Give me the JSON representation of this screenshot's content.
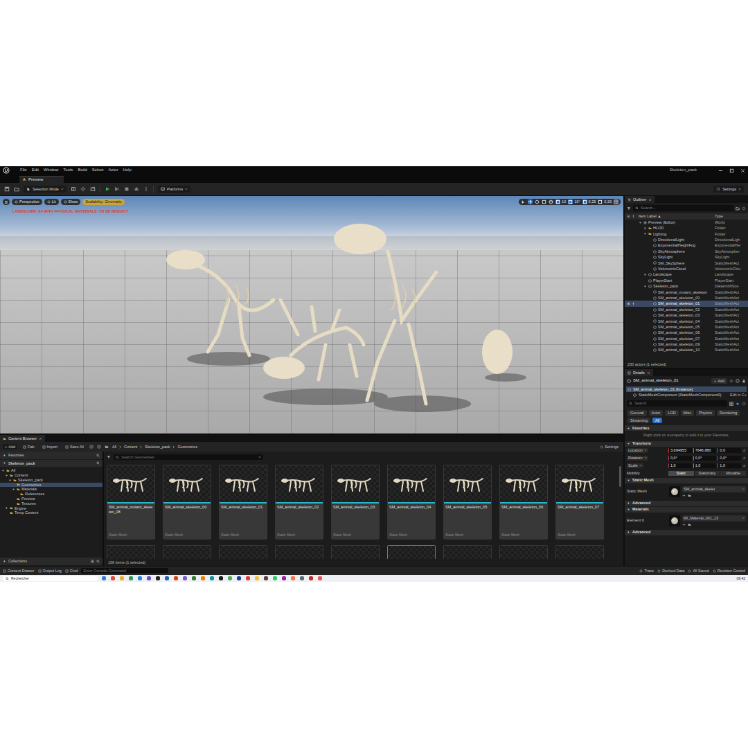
{
  "window": {
    "title": "Skeleton_pack",
    "menu": [
      "File",
      "Edit",
      "Window",
      "Tools",
      "Build",
      "Select",
      "Actor",
      "Help"
    ],
    "tab": "Preview"
  },
  "toolbar": {
    "mode": "Selection Mode",
    "platforms": "Platforms",
    "settings": "Settings"
  },
  "viewport": {
    "buttons": [
      "Perspective",
      "Lit",
      "Show"
    ],
    "scalability": "Scalability: Cinematic",
    "warning": "LANDSCAPE: 64 WITH PHYSICAL MATERIALS: TO BE REBUILT",
    "snaps": [
      {
        "value": "10",
        "on": true
      },
      {
        "value": "10°",
        "on": true
      },
      {
        "value": "0,25",
        "on": true
      },
      {
        "value": "0,33",
        "on": false
      }
    ]
  },
  "outliner": {
    "title": "Outliner",
    "search": "Search...",
    "columns": [
      "Item Label ▲",
      "Type"
    ],
    "footer": "230 actors (1 selected)",
    "rows": [
      {
        "label": "Preview (Editor)",
        "type": "World",
        "depth": 0,
        "kind": "world",
        "has_children": true,
        "expanded": true,
        "selected": false
      },
      {
        "label": "HLOD",
        "type": "Folder",
        "depth": 1,
        "kind": "folder",
        "has_children": true,
        "expanded": false,
        "selected": false
      },
      {
        "label": "Lighting",
        "type": "Folder",
        "depth": 1,
        "kind": "folder",
        "has_children": true,
        "expanded": true,
        "selected": false
      },
      {
        "label": "DirectionalLight",
        "type": "DirectionalLigh",
        "depth": 2,
        "kind": "actor",
        "has_children": false,
        "expanded": false,
        "selected": false
      },
      {
        "label": "ExponentialHeightFog",
        "type": "ExponentialHei",
        "depth": 2,
        "kind": "actor",
        "has_children": false,
        "expanded": false,
        "selected": false
      },
      {
        "label": "SkyAtmosphere",
        "type": "SkyAtmospher",
        "depth": 2,
        "kind": "actor",
        "has_children": false,
        "expanded": false,
        "selected": false
      },
      {
        "label": "SkyLight",
        "type": "SkyLight",
        "depth": 2,
        "kind": "actor",
        "has_children": false,
        "expanded": false,
        "selected": false
      },
      {
        "label": "SM_SkySphere",
        "type": "StaticMeshAct",
        "depth": 2,
        "kind": "actor",
        "has_children": false,
        "expanded": false,
        "selected": false
      },
      {
        "label": "VolumetricCloud",
        "type": "VolumetricClou",
        "depth": 2,
        "kind": "actor",
        "has_children": false,
        "expanded": false,
        "selected": false
      },
      {
        "label": "Landscape",
        "type": "Landscape",
        "depth": 1,
        "kind": "actor",
        "has_children": true,
        "expanded": false,
        "selected": false
      },
      {
        "label": "PlayerStart",
        "type": "PlayerStart",
        "depth": 1,
        "kind": "actor",
        "has_children": false,
        "expanded": false,
        "selected": false
      },
      {
        "label": "Skeleton_pack",
        "type": "DatasmithSce",
        "depth": 1,
        "kind": "actor",
        "has_children": true,
        "expanded": true,
        "selected": false
      },
      {
        "label": "SM_animal_mutant_skeleton",
        "type": "StaticMeshAct",
        "depth": 2,
        "kind": "actor",
        "has_children": false,
        "expanded": false,
        "selected": false
      },
      {
        "label": "SM_animal_skeleton_00",
        "type": "StaticMeshAct",
        "depth": 2,
        "kind": "actor",
        "has_children": false,
        "expanded": false,
        "selected": false
      },
      {
        "label": "SM_animal_skeleton_01",
        "type": "StaticMeshAct",
        "depth": 2,
        "kind": "actor",
        "has_children": false,
        "expanded": false,
        "selected": true
      },
      {
        "label": "SM_animal_skeleton_02",
        "type": "StaticMeshAct",
        "depth": 2,
        "kind": "actor",
        "has_children": false,
        "expanded": false,
        "selected": false
      },
      {
        "label": "SM_animal_skeleton_03",
        "type": "StaticMeshAct",
        "depth": 2,
        "kind": "actor",
        "has_children": false,
        "expanded": false,
        "selected": false
      },
      {
        "label": "SM_animal_skeleton_04",
        "type": "StaticMeshAct",
        "depth": 2,
        "kind": "actor",
        "has_children": false,
        "expanded": false,
        "selected": false
      },
      {
        "label": "SM_animal_skeleton_05",
        "type": "StaticMeshAct",
        "depth": 2,
        "kind": "actor",
        "has_children": false,
        "expanded": false,
        "selected": false
      },
      {
        "label": "SM_animal_skeleton_06",
        "type": "StaticMeshAct",
        "depth": 2,
        "kind": "actor",
        "has_children": false,
        "expanded": false,
        "selected": false
      },
      {
        "label": "SM_animal_skeleton_07",
        "type": "StaticMeshAct",
        "depth": 2,
        "kind": "actor",
        "has_children": false,
        "expanded": false,
        "selected": false
      },
      {
        "label": "SM_animal_skeleton_09",
        "type": "StaticMeshAct",
        "depth": 2,
        "kind": "actor",
        "has_children": false,
        "expanded": false,
        "selected": false
      },
      {
        "label": "SM_animal_skeleton_10",
        "type": "StaticMeshAct",
        "depth": 2,
        "kind": "actor",
        "has_children": false,
        "expanded": false,
        "selected": false
      }
    ]
  },
  "details": {
    "title": "Details",
    "actor": "SM_animal_skeleton_01",
    "add_icon": "+",
    "add": "Add",
    "components": [
      {
        "label": "SM_animal_skeleton_01 (Instance)",
        "action": "",
        "selected": true
      },
      {
        "label": "StaticMeshComponent (StaticMeshComponent0)",
        "action": "Edit in C+",
        "selected": false
      }
    ],
    "search": "Search",
    "filters": [
      {
        "label": "General",
        "selected": false
      },
      {
        "label": "Actor",
        "selected": false
      },
      {
        "label": "LOD",
        "selected": false
      },
      {
        "label": "Misc",
        "selected": false
      },
      {
        "label": "Physics",
        "selected": false
      },
      {
        "label": "Rendering",
        "selected": false
      },
      {
        "label": "Streaming",
        "selected": false
      },
      {
        "label": "All",
        "selected": true
      }
    ],
    "sections": [
      {
        "title": "Favorites",
        "kind": "hint",
        "expanded": true,
        "text": "Right click on a property to add it to your Favorites."
      },
      {
        "title": "Transform",
        "kind": "transform",
        "expanded": true,
        "rows": [
          {
            "label": "Location",
            "values": [
              "3,694955",
              "7646,880",
              "0,0"
            ]
          },
          {
            "label": "Rotation",
            "values": [
              "0,0°",
              "0,0°",
              "0,0°"
            ]
          },
          {
            "label": "Scale",
            "values": [
              "1,0",
              "1,0",
              "1,0"
            ]
          }
        ],
        "mobility": {
          "label": "Mobility",
          "options": [
            {
              "label": "Static",
              "selected": true
            },
            {
              "label": "Stationary",
              "selected": false
            },
            {
              "label": "Movable",
              "selected": false
            }
          ]
        }
      },
      {
        "title": "Static Mesh",
        "kind": "asset",
        "expanded": true,
        "label": "Static Mesh",
        "value": "SM_animal_skelet"
      },
      {
        "title": "Advanced",
        "kind": "collapsed",
        "expanded": false
      },
      {
        "title": "Materials",
        "kind": "asset",
        "expanded": true,
        "label": "Element 0",
        "value": "MI_Material_001_13"
      },
      {
        "title": "Advanced",
        "kind": "collapsed",
        "expanded": false
      }
    ]
  },
  "content_browser": {
    "title": "Content Browser",
    "actions": [
      {
        "icon": "+",
        "label": "Add"
      },
      {
        "icon": "",
        "label": "Fab"
      },
      {
        "icon": "",
        "label": "Import"
      },
      {
        "icon": "",
        "label": "Save All"
      }
    ],
    "breadcrumb": [
      "All",
      "Content",
      "Skeleton_pack",
      "Geometries"
    ],
    "settings": "Settings",
    "favorites": "Favorites",
    "root": "Skeleton_pack",
    "collections": "Collections",
    "tree": [
      {
        "label": "All",
        "depth": 0,
        "has_children": true,
        "expanded": true,
        "selected": false
      },
      {
        "label": "Content",
        "depth": 1,
        "has_children": true,
        "expanded": true,
        "selected": false
      },
      {
        "label": "Skeleton_pack",
        "depth": 2,
        "has_children": true,
        "expanded": true,
        "selected": false
      },
      {
        "label": "Geometries",
        "depth": 3,
        "has_children": false,
        "expanded": false,
        "selected": true
      },
      {
        "label": "Materials",
        "depth": 3,
        "has_children": true,
        "expanded": true,
        "selected": false
      },
      {
        "label": "References",
        "depth": 4,
        "has_children": false,
        "expanded": false,
        "selected": false
      },
      {
        "label": "Preview",
        "depth": 3,
        "has_children": false,
        "expanded": false,
        "selected": false
      },
      {
        "label": "Textures",
        "depth": 3,
        "has_children": false,
        "expanded": false,
        "selected": false
      },
      {
        "label": "Engine",
        "depth": 1,
        "has_children": true,
        "expanded": false,
        "selected": false
      },
      {
        "label": "Temp Content",
        "depth": 1,
        "has_children": false,
        "expanded": false,
        "selected": false
      }
    ],
    "search": "Search Geometries",
    "items": [
      {
        "name": "SM_animal_mutant_skeleton_08",
        "type": "Static Mesh",
        "selected": false
      },
      {
        "name": "SM_animal_skeleton_00",
        "type": "Static Mesh",
        "selected": false
      },
      {
        "name": "SM_animal_skeleton_01",
        "type": "Static Mesh",
        "selected": false
      },
      {
        "name": "SM_animal_skeleton_02",
        "type": "Static Mesh",
        "selected": false
      },
      {
        "name": "SM_animal_skeleton_03",
        "type": "Static Mesh",
        "selected": false
      },
      {
        "name": "SM_animal_skeleton_04",
        "type": "Static Mesh",
        "selected": false
      },
      {
        "name": "SM_animal_skeleton_05",
        "type": "Static Mesh",
        "selected": false
      },
      {
        "name": "SM_animal_skeleton_06",
        "type": "Static Mesh",
        "selected": false
      },
      {
        "name": "SM_animal_skeleton_07",
        "type": "Static Mesh",
        "selected": false
      }
    ],
    "partial_items": [
      {
        "selected": false
      },
      {
        "selected": false
      },
      {
        "selected": false
      },
      {
        "selected": false
      },
      {
        "selected": false
      },
      {
        "selected": true
      },
      {
        "selected": false
      },
      {
        "selected": false
      },
      {
        "selected": false
      }
    ],
    "footer": "106 items (1 selected)"
  },
  "status_bar": {
    "left": [
      "Content Drawer",
      "Output Log",
      "Cmd"
    ],
    "console": "Enter Console Command",
    "right": [
      "Trace",
      "Derived Data",
      "All Saved",
      "Revision Control"
    ]
  },
  "taskbar": {
    "search": "Rechercher",
    "time": "09:42",
    "apps": [
      {
        "color": "#3a7bd5"
      },
      {
        "color": "#e04a3a"
      },
      {
        "color": "#e8b020"
      },
      {
        "color": "#2a9d5a"
      },
      {
        "color": "#1e88e5"
      },
      {
        "color": "#6a4fc8"
      },
      {
        "color": "#222222"
      },
      {
        "color": "#1565c0"
      },
      {
        "color": "#d84315"
      },
      {
        "color": "#7b5cd6"
      },
      {
        "color": "#2e7d32"
      },
      {
        "color": "#f57c00"
      },
      {
        "color": "#0097a7"
      },
      {
        "color": "#1a1a1a"
      },
      {
        "color": "#4caf50"
      },
      {
        "color": "#0d47a1"
      },
      {
        "color": "#e53935"
      },
      {
        "color": "#fbc02d"
      },
      {
        "color": "#5d4037"
      },
      {
        "color": "#25d366"
      },
      {
        "color": "#8e24aa"
      },
      {
        "color": "#ff7043"
      },
      {
        "color": "#546e7a"
      },
      {
        "color": "#c62828"
      },
      {
        "color": "#ef5350"
      }
    ]
  }
}
